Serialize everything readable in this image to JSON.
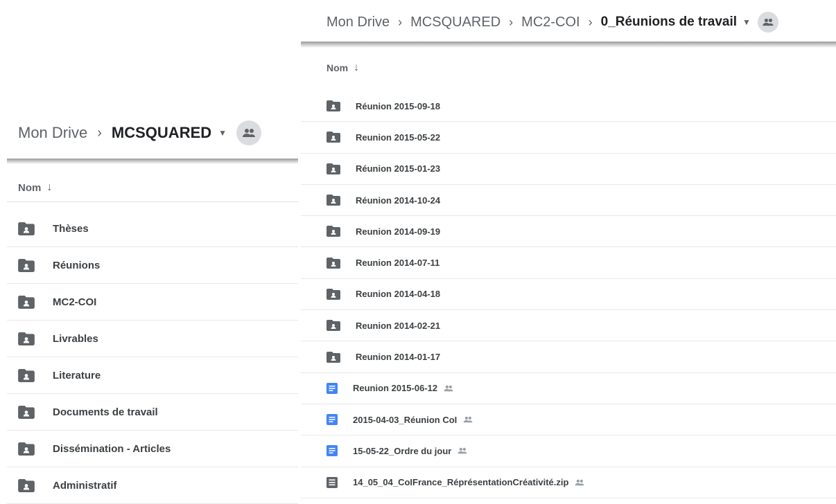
{
  "left": {
    "breadcrumb": {
      "root": "Mon Drive",
      "current": "MCSQUARED"
    },
    "column_header": "Nom",
    "items": [
      {
        "name": "Thèses",
        "icon": "shared-folder-icon"
      },
      {
        "name": "Réunions",
        "icon": "shared-folder-icon"
      },
      {
        "name": "MC2-COI",
        "icon": "shared-folder-icon"
      },
      {
        "name": "Livrables",
        "icon": "shared-folder-icon"
      },
      {
        "name": "Literature",
        "icon": "shared-folder-icon"
      },
      {
        "name": "Documents de travail",
        "icon": "shared-folder-icon"
      },
      {
        "name": "Dissémination - Articles",
        "icon": "shared-folder-icon"
      },
      {
        "name": "Administratif",
        "icon": "shared-folder-icon"
      }
    ]
  },
  "right": {
    "breadcrumb": {
      "root": "Mon Drive",
      "level1": "MCSQUARED",
      "level2": "MC2-COI",
      "current": "0_Réunions de travail"
    },
    "column_header": "Nom",
    "items": [
      {
        "name": "Réunion 2015-09-18",
        "type": "folder",
        "shared": false
      },
      {
        "name": "Reunion 2015-05-22",
        "type": "folder",
        "shared": false
      },
      {
        "name": "Réunion 2015-01-23",
        "type": "folder",
        "shared": false
      },
      {
        "name": "Réunion 2014-10-24",
        "type": "folder",
        "shared": false
      },
      {
        "name": "Reunion 2014-09-19",
        "type": "folder",
        "shared": false
      },
      {
        "name": "Reunion 2014-07-11",
        "type": "folder",
        "shared": false
      },
      {
        "name": "Reunion 2014-04-18",
        "type": "folder",
        "shared": false
      },
      {
        "name": "Reunion 2014-02-21",
        "type": "folder",
        "shared": false
      },
      {
        "name": "Reunion 2014-01-17",
        "type": "folder",
        "shared": false
      },
      {
        "name": "Reunion 2015-06-12",
        "type": "doc",
        "shared": true
      },
      {
        "name": "2015-04-03_Réunion CoI",
        "type": "doc",
        "shared": true
      },
      {
        "name": "15-05-22_Ordre du jour",
        "type": "doc",
        "shared": true
      },
      {
        "name": "14_05_04_CoIFrance_RéprésentationCréativité.zip",
        "type": "zip",
        "shared": true
      }
    ]
  },
  "colors": {
    "folder": "#5f6368",
    "doc": "#4285f4",
    "zip": "#5f6368",
    "avatar_bg": "#dadce0"
  }
}
